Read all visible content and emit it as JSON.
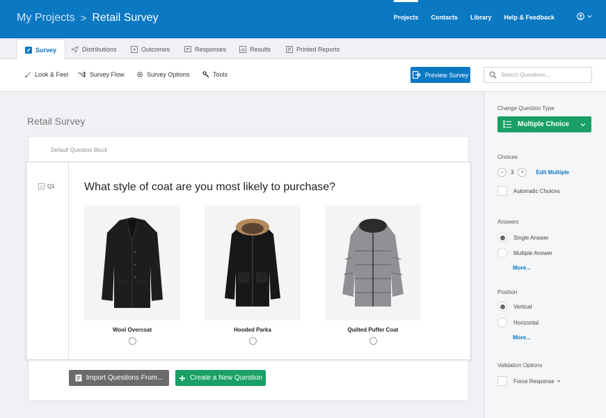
{
  "header": {
    "breadcrumb_root": "My Projects",
    "breadcrumb_sep": ">",
    "breadcrumb_current": "Retail Survey",
    "nav": [
      "Projects",
      "Contacts",
      "Library",
      "Help & Feedback"
    ],
    "user_icon": "user-circle-icon"
  },
  "tabs": [
    {
      "label": "Survey",
      "icon": "pencil-icon"
    },
    {
      "label": "Distributions",
      "icon": "send-icon"
    },
    {
      "label": "Outcomes",
      "icon": "outcomes-icon"
    },
    {
      "label": "Responses",
      "icon": "responses-icon"
    },
    {
      "label": "Results",
      "icon": "results-icon"
    },
    {
      "label": "Printed Reports",
      "icon": "reports-icon"
    }
  ],
  "toolbar": {
    "look_feel": "Look & Feel",
    "survey_flow": "Survey Flow",
    "survey_options": "Survey Options",
    "tools": "Tools",
    "preview": "Preview Survey",
    "search_placeholder": "Search Questions..."
  },
  "main": {
    "survey_title": "Retail Survey",
    "block_name": "Default Question Block",
    "question": {
      "id": "Q1",
      "text": "What style of coat are you most likely to purchase?",
      "choices": [
        {
          "label": "Wool Overcoat",
          "image": "black-wool-overcoat"
        },
        {
          "label": "Hooded Parka",
          "image": "black-hooded-parka-fur-trim"
        },
        {
          "label": "Quilted Puffer Coat",
          "image": "grey-quilted-puffer-coat"
        }
      ]
    },
    "import_button": "Import Questions From...",
    "create_button": "Create a New Question"
  },
  "panel": {
    "change_type_label": "Change Question Type",
    "question_type": "Multiple Choice",
    "choices_label": "Choices",
    "choices_count": "3",
    "edit_multiple": "Edit Multiple",
    "automatic_choices": "Automatic Choices",
    "answers_label": "Answers",
    "single_answer": "Single Answer",
    "multiple_answer": "Multiple Answer",
    "more": "More...",
    "position_label": "Position",
    "vertical": "Vertical",
    "horizontal": "Horizontal",
    "validation_label": "Validation Options",
    "force_response": "Force Response",
    "selected_answer": "Single Answer",
    "selected_position": "Vertical"
  },
  "colors": {
    "brand_blue": "#0b78c2",
    "action_green": "#1aa067",
    "import_gray": "#6b6b6b"
  }
}
